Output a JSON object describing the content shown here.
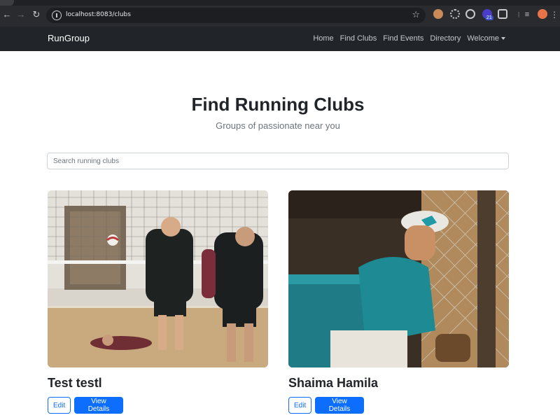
{
  "browser": {
    "url": "localhost:8083/clubs",
    "badge": "21"
  },
  "navbar": {
    "brand": "RunGroup",
    "links": [
      "Home",
      "Find Clubs",
      "Find Events",
      "Directory",
      "Welcome"
    ]
  },
  "hero": {
    "title": "Find Running Clubs",
    "subtitle": "Groups of passionate near you"
  },
  "search": {
    "placeholder": "Search running clubs",
    "value": ""
  },
  "clubs": [
    {
      "name": "Test testl",
      "edit_label": "Edit",
      "details_label": "View Details",
      "image": "volleyball-players"
    },
    {
      "name": "Shaima Hamila",
      "edit_label": "Edit",
      "details_label": "View Details",
      "image": "baseball-player"
    }
  ],
  "colors": {
    "primary": "#0d6efd",
    "navbar": "#212529",
    "text": "#212529",
    "muted": "#6c757d"
  }
}
